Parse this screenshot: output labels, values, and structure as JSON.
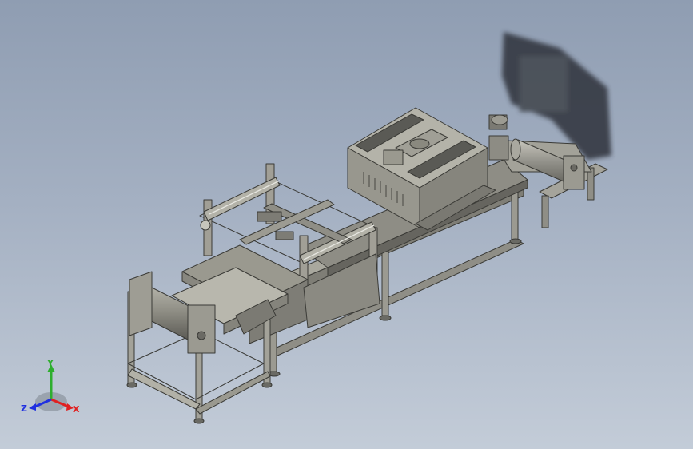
{
  "viewport": {
    "background_top": "#8f9db2",
    "background_bottom": "#c3ccd8",
    "model_color": "#8c8b82",
    "shadow_color": "#2b2f36"
  },
  "triad": {
    "x_label": "X",
    "y_label": "Y",
    "z_label": "Z",
    "x_color": "#e02020",
    "y_color": "#2eae2e",
    "z_color": "#2030e0"
  }
}
